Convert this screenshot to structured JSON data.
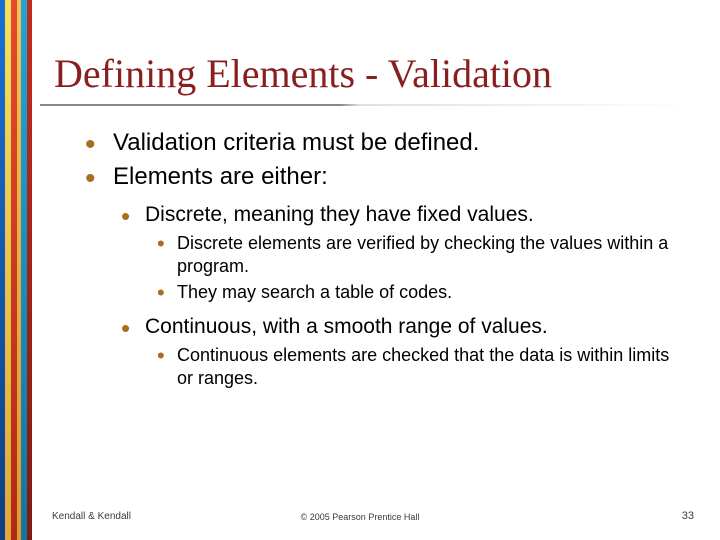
{
  "title": "Defining Elements - Validation",
  "bullets": {
    "l1a": "Validation criteria must be defined.",
    "l1b": "Elements are either:",
    "l2a": "Discrete, meaning they have fixed values.",
    "l3a": "Discrete elements are verified by checking the values within a program.",
    "l3b": "They may search a table of codes.",
    "l2b": "Continuous, with a smooth range of values.",
    "l3c": "Continuous elements are checked that the data is within limits or ranges."
  },
  "footer": {
    "left": "Kendall & Kendall",
    "center": "© 2005 Pearson Prentice Hall",
    "right": "33"
  }
}
